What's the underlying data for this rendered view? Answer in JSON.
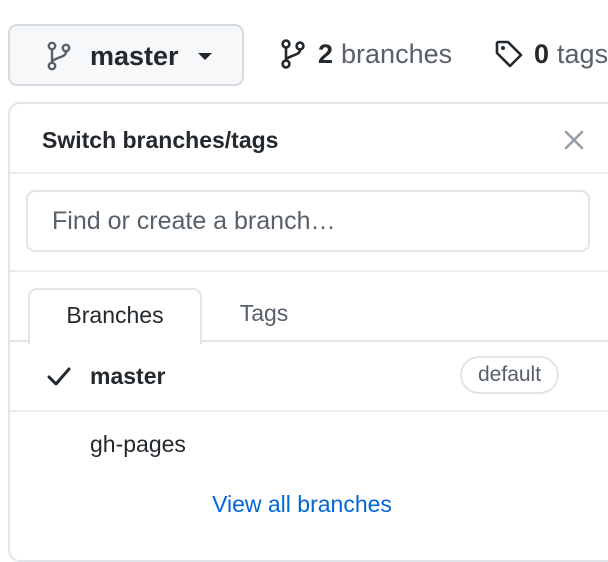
{
  "branch_button": {
    "label": "master",
    "icon": "git-branch-icon"
  },
  "stats": {
    "branches": {
      "count": "2",
      "label": "branches",
      "icon": "git-branch-icon"
    },
    "tags": {
      "count": "0",
      "label": "tags",
      "icon": "tag-icon"
    }
  },
  "dropdown": {
    "title": "Switch branches/tags",
    "close_icon": "x-icon",
    "filter": {
      "placeholder": "Find or create a branch…",
      "value": ""
    },
    "tabs": [
      {
        "label": "Branches",
        "active": true
      },
      {
        "label": "Tags",
        "active": false
      }
    ],
    "branches": [
      {
        "name": "master",
        "selected": true,
        "badge": "default"
      },
      {
        "name": "gh-pages",
        "selected": false
      }
    ],
    "view_all_label": "View all branches"
  },
  "colors": {
    "link": "#0366d6",
    "muted": "#586069",
    "text": "#24292e",
    "border": "#e1e4e8"
  }
}
